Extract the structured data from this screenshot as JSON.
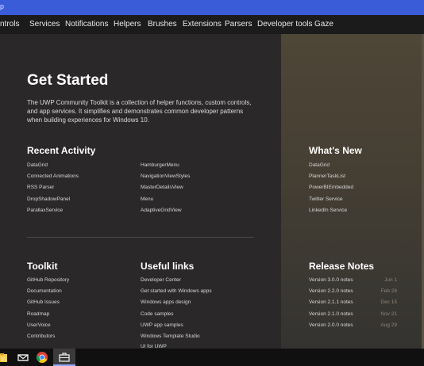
{
  "window": {
    "title_fragment": "p"
  },
  "nav": {
    "items": [
      "ntrols",
      "Services",
      "Notifications",
      "Helpers",
      "Brushes",
      "Extensions",
      "Parsers",
      "Developer tools",
      "Gaze"
    ]
  },
  "hero": {
    "title": "Get Started",
    "description": "The UWP Community Toolkit is a collection of helper functions, custom controls, and app services. It simplifies and demonstrates common developer patterns when building experiences for Windows 10."
  },
  "recent_activity": {
    "title": "Recent Activity",
    "col1": [
      "DataGrid",
      "Connected Animations",
      "RSS Parser",
      "DropShadowPanel",
      "ParallaxService"
    ],
    "col2": [
      "HamburgerMenu",
      "NavigationViewStyles",
      "MasterDetailsView",
      "Menu",
      "AdaptiveGridView"
    ]
  },
  "whats_new": {
    "title": "What's New",
    "items": [
      "DataGrid",
      "PlannerTaskList",
      "PowerBIEmbedded",
      "Twitter Service",
      "LinkedIn Service"
    ]
  },
  "toolkit": {
    "title": "Toolkit",
    "items": [
      "GitHub Repository",
      "Documentation",
      "GitHub Issues",
      "Roadmap",
      "UserVoice",
      "Contributors"
    ]
  },
  "useful_links": {
    "title": "Useful links",
    "items": [
      "Developer Center",
      "Get started with Windows apps",
      "Windows apps design",
      "Code samples",
      "UWP app samples",
      "Windows Template Studio",
      "UI for UWP"
    ]
  },
  "release_notes": {
    "title": "Release Notes",
    "items": [
      {
        "label": "Version 3.0.0 notes",
        "date": "Jun 1"
      },
      {
        "label": "Version 2.2.0 notes",
        "date": "Feb 28"
      },
      {
        "label": "Version 2.1.1 notes",
        "date": "Dec 15"
      },
      {
        "label": "Version 2.1.0 notes",
        "date": "Nov 21"
      },
      {
        "label": "Version 2.0.0 notes",
        "date": "Aug 29"
      }
    ]
  },
  "taskbar": {
    "icons": [
      "file-explorer-icon",
      "mail-icon",
      "chrome-icon",
      "toolkit-app-icon"
    ]
  },
  "colors": {
    "titlebar": "#3a5cd9",
    "navbar": "#1b1b1b",
    "main_bg": "#2a2828",
    "right_panel": "#4e4637",
    "taskbar": "#101010"
  }
}
